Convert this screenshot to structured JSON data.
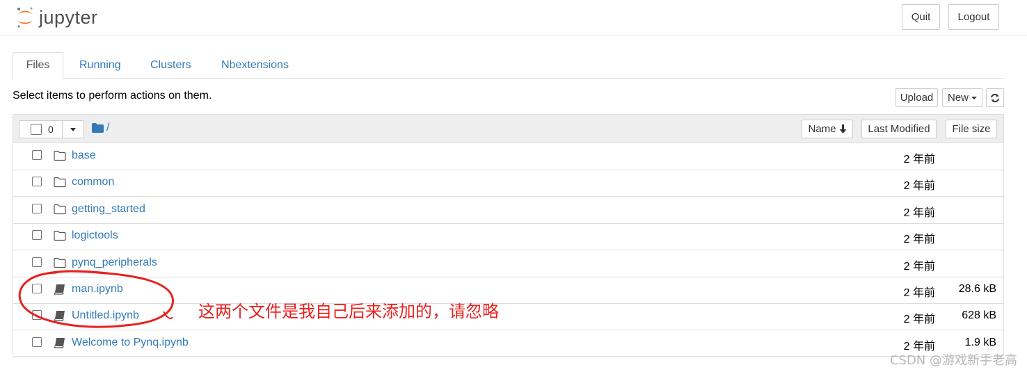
{
  "header": {
    "logo_text": "jupyter",
    "quit_label": "Quit",
    "logout_label": "Logout"
  },
  "tabs": [
    {
      "label": "Files"
    },
    {
      "label": "Running"
    },
    {
      "label": "Clusters"
    },
    {
      "label": "Nbextensions"
    }
  ],
  "hint": "Select items to perform actions on them.",
  "toolbar": {
    "upload_label": "Upload",
    "new_label": "New"
  },
  "list_header": {
    "selected_count": "0",
    "path": "/",
    "sort_name_label": "Name",
    "last_modified_label": "Last Modified",
    "file_size_label": "File size"
  },
  "files": [
    {
      "name": "base",
      "type": "folder",
      "modified": "2 年前",
      "size": ""
    },
    {
      "name": "common",
      "type": "folder",
      "modified": "2 年前",
      "size": ""
    },
    {
      "name": "getting_started",
      "type": "folder",
      "modified": "2 年前",
      "size": ""
    },
    {
      "name": "logictools",
      "type": "folder",
      "modified": "2 年前",
      "size": ""
    },
    {
      "name": "pynq_peripherals",
      "type": "folder",
      "modified": "2 年前",
      "size": ""
    },
    {
      "name": "man.ipynb",
      "type": "notebook",
      "modified": "2 年前",
      "size": "28.6 kB"
    },
    {
      "name": "Untitled.ipynb",
      "type": "notebook",
      "modified": "2 年前",
      "size": "628 kB"
    },
    {
      "name": "Welcome to Pynq.ipynb",
      "type": "notebook",
      "modified": "2 年前",
      "size": "1.9 kB"
    }
  ],
  "annotation": "这两个文件是我自己后来添加的，请忽略",
  "watermark": "CSDN @游戏新手老高",
  "colors": {
    "link": "#337ab7",
    "annotation": "#e8211e",
    "logo_orange": "#f37726"
  }
}
